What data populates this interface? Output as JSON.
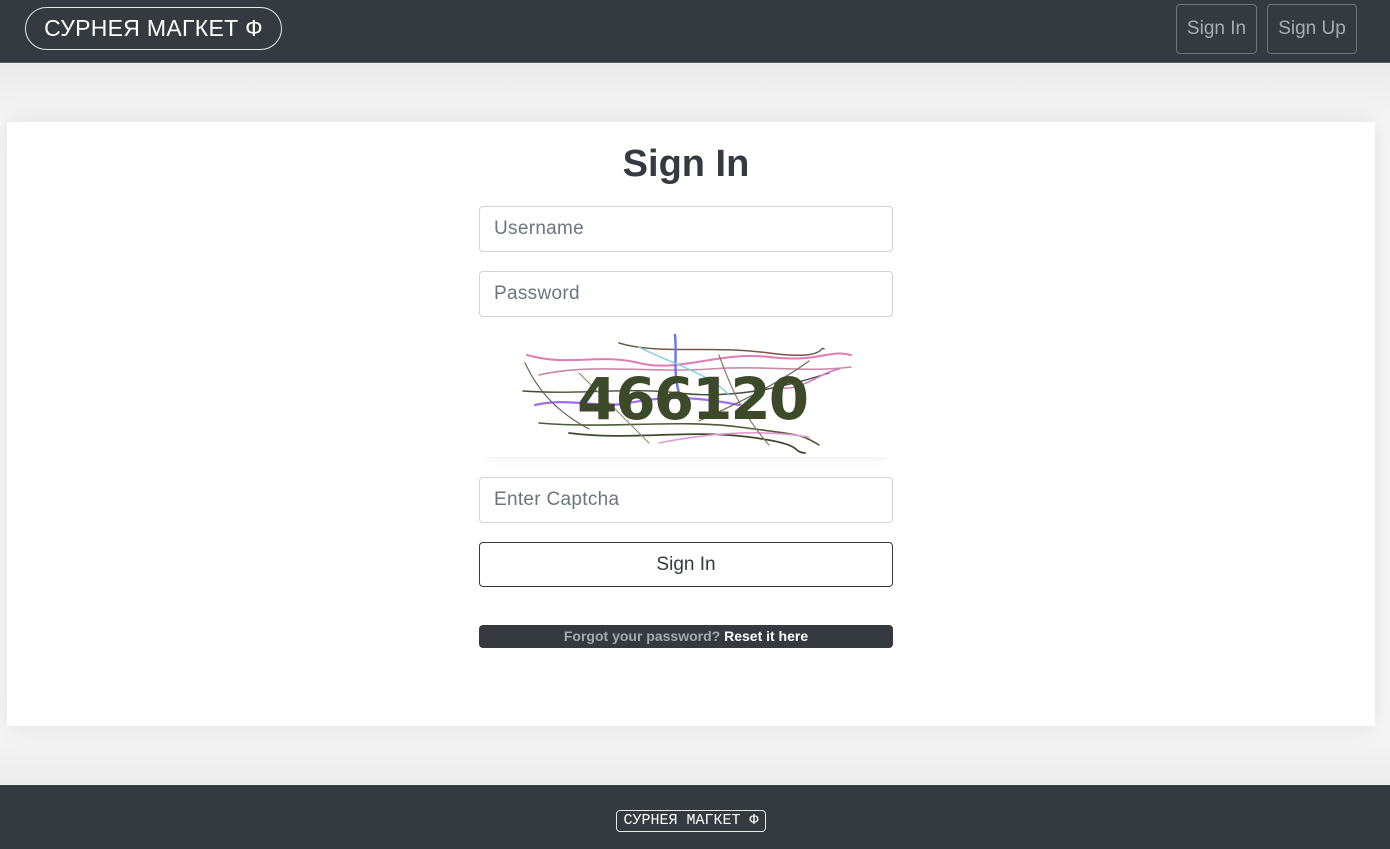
{
  "navbar": {
    "brand": "СУРНЕЯ МАГКЕТ Ф",
    "sign_in": "Sign In",
    "sign_up": "Sign Up"
  },
  "form": {
    "title": "Sign In",
    "username_placeholder": "Username",
    "password_placeholder": "Password",
    "captcha_text": "466120",
    "captcha_placeholder": "Enter Captcha",
    "submit_label": "Sign In",
    "forgot_text": "Forgot your password?",
    "reset_link": "Reset it here"
  },
  "footer": {
    "brand": "СУРНЕЯ МАГКЕТ Ф"
  },
  "colors": {
    "navbar_bg": "#343a40",
    "captcha_text": "#3d4a2a"
  }
}
